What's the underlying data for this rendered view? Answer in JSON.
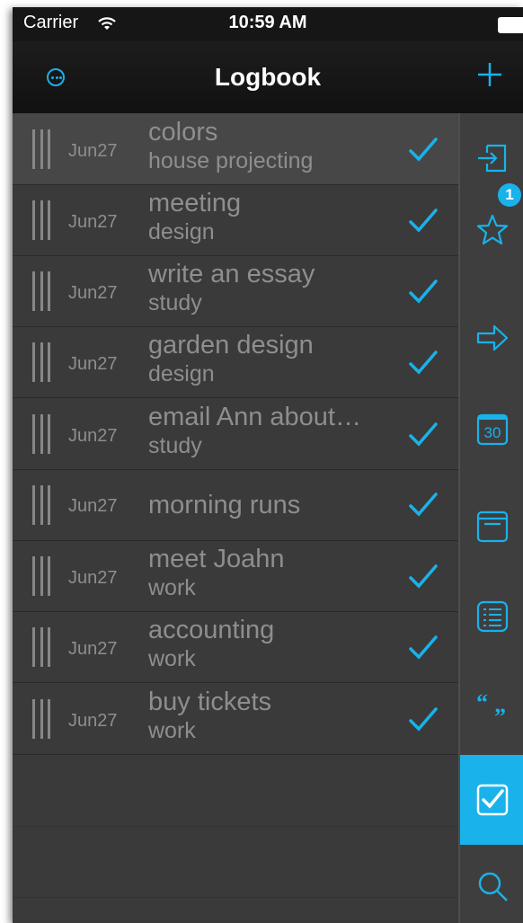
{
  "status": {
    "carrier": "Carrier",
    "time": "10:59 AM"
  },
  "nav": {
    "title": "Logbook"
  },
  "items": [
    {
      "date": "Jun27",
      "title": "colors",
      "subtitle": "house projecting"
    },
    {
      "date": "Jun27",
      "title": "meeting",
      "subtitle": "design"
    },
    {
      "date": "Jun27",
      "title": "write an essay",
      "subtitle": "study"
    },
    {
      "date": "Jun27",
      "title": "garden design",
      "subtitle": "design"
    },
    {
      "date": "Jun27",
      "title": "email Ann about…",
      "subtitle": "study"
    },
    {
      "date": "Jun27",
      "title": "morning runs",
      "subtitle": ""
    },
    {
      "date": "Jun27",
      "title": "meet Joahn",
      "subtitle": "work"
    },
    {
      "date": "Jun27",
      "title": "accounting",
      "subtitle": "work"
    },
    {
      "date": "Jun27",
      "title": "buy tickets",
      "subtitle": "work"
    }
  ],
  "sidebar": {
    "items": [
      {
        "icon": "inbox-icon"
      },
      {
        "icon": "star-icon",
        "badge": "1"
      },
      {
        "icon": "arrow-right-icon"
      },
      {
        "icon": "calendar-icon",
        "calendar_day": "30"
      },
      {
        "icon": "box-icon"
      },
      {
        "icon": "list-icon"
      },
      {
        "icon": "quote-icon"
      },
      {
        "icon": "checkbox-icon",
        "active": true
      },
      {
        "icon": "search-icon"
      }
    ]
  },
  "colors": {
    "accent": "#19b2ea",
    "background": "#3a3a3a",
    "text": "#8e8e8e",
    "navbar": "#161616"
  }
}
